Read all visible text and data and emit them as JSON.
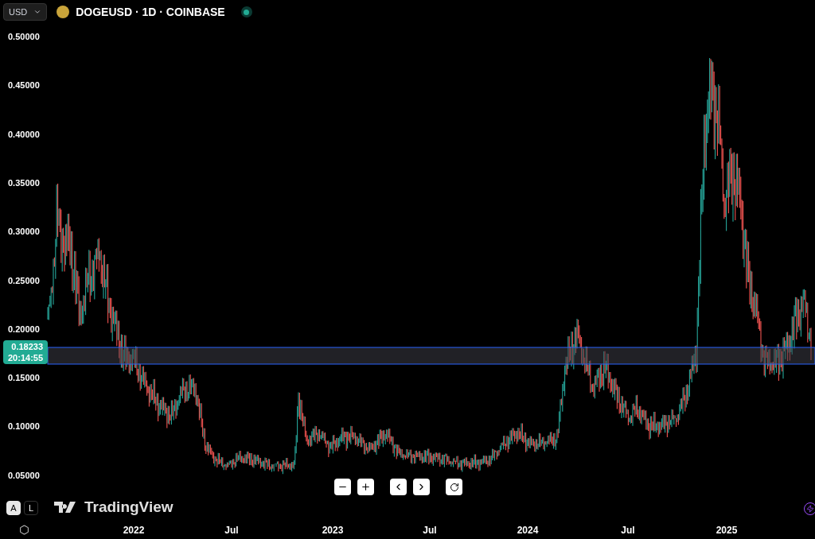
{
  "toolbar": {
    "currency": "USD",
    "symbol_title": "DOGEUSD · 1D · COINBASE",
    "market_open": true
  },
  "price_axis": [
    "0.50000",
    "0.45000",
    "0.40000",
    "0.35000",
    "0.30000",
    "0.25000",
    "0.20000",
    "0.15000",
    "0.10000",
    "0.05000"
  ],
  "current_price": {
    "value": "0.18233",
    "countdown": "20:14:55"
  },
  "time_axis": [
    "2022",
    "Jul",
    "2023",
    "Jul",
    "2024",
    "Jul",
    "2025"
  ],
  "scale_buttons": [
    {
      "label": "A",
      "selected": true
    },
    {
      "label": "L",
      "selected": false
    }
  ],
  "logo": "TradingView"
}
